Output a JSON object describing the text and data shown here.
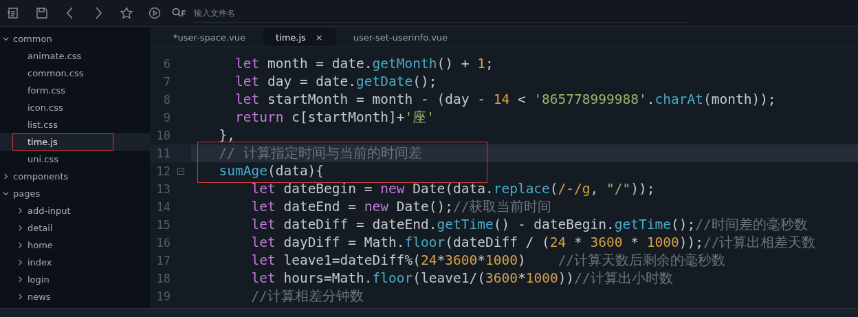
{
  "toolbar": {
    "icons": [
      {
        "kind": "new-file"
      },
      {
        "kind": "save"
      },
      {
        "kind": "back"
      },
      {
        "kind": "forward"
      },
      {
        "kind": "star"
      },
      {
        "kind": "run"
      }
    ],
    "search": {
      "placeholder": "输入文件名"
    }
  },
  "sidebar": {
    "items": [
      {
        "label": "common",
        "expanded": true,
        "selected": false,
        "outlined": false,
        "children": [
          {
            "label": "animate.css",
            "selected": false,
            "outlined": false
          },
          {
            "label": "common.css",
            "selected": false,
            "outlined": false
          },
          {
            "label": "form.css",
            "selected": false,
            "outlined": false
          },
          {
            "label": "icon.css",
            "selected": false,
            "outlined": false
          },
          {
            "label": "list.css",
            "selected": false,
            "outlined": false
          },
          {
            "label": "time.js",
            "selected": true,
            "outlined": true
          },
          {
            "label": "uni.css",
            "selected": false,
            "outlined": false
          }
        ]
      },
      {
        "label": "components",
        "expanded": false,
        "selected": false,
        "outlined": false
      },
      {
        "label": "pages",
        "expanded": true,
        "selected": false,
        "outlined": false,
        "children": [
          {
            "label": "add-input",
            "expanded": false,
            "selected": false,
            "outlined": false
          },
          {
            "label": "detail",
            "expanded": false,
            "selected": false,
            "outlined": false
          },
          {
            "label": "home",
            "expanded": false,
            "selected": false,
            "outlined": false
          },
          {
            "label": "index",
            "expanded": false,
            "selected": false,
            "outlined": false
          },
          {
            "label": "login",
            "expanded": false,
            "selected": false,
            "outlined": false
          },
          {
            "label": "news",
            "expanded": false,
            "selected": false,
            "outlined": false
          }
        ]
      }
    ]
  },
  "tabs": [
    {
      "label": "*user-space.vue",
      "selected": false
    },
    {
      "label": "time.js",
      "selected": true,
      "close": "×"
    },
    {
      "label": "user-set-userinfo.vue",
      "selected": false
    }
  ],
  "editor": {
    "lines": [
      {
        "number": "6",
        "current": false,
        "outlined": false,
        "foldable": false,
        "tokens": [
          {
            "kind": "kw",
            "text": "    let"
          },
          {
            "kind": "plain",
            "text": " month = date."
          },
          {
            "kind": "fn",
            "text": "getMonth"
          },
          {
            "kind": "plain",
            "text": "() + "
          },
          {
            "kind": "num",
            "text": "1"
          },
          {
            "kind": "plain",
            "text": ";"
          }
        ]
      },
      {
        "number": "7",
        "current": false,
        "outlined": false,
        "foldable": false,
        "tokens": [
          {
            "kind": "kw",
            "text": "    let"
          },
          {
            "kind": "plain",
            "text": " day = date."
          },
          {
            "kind": "fn",
            "text": "getDate"
          },
          {
            "kind": "plain",
            "text": "();"
          }
        ]
      },
      {
        "number": "8",
        "current": false,
        "outlined": false,
        "foldable": false,
        "tokens": [
          {
            "kind": "kw",
            "text": "    let"
          },
          {
            "kind": "plain",
            "text": " startMonth = month - (day - "
          },
          {
            "kind": "num",
            "text": "14"
          },
          {
            "kind": "plain",
            "text": " < "
          },
          {
            "kind": "str",
            "text": "'865778999988'"
          },
          {
            "kind": "plain",
            "text": "."
          },
          {
            "kind": "fn",
            "text": "charAt"
          },
          {
            "kind": "plain",
            "text": "(month));"
          }
        ]
      },
      {
        "number": "9",
        "current": false,
        "outlined": false,
        "foldable": false,
        "tokens": [
          {
            "kind": "kw",
            "text": "    return"
          },
          {
            "kind": "plain",
            "text": " c[startMonth]+"
          },
          {
            "kind": "str",
            "text": "'座'"
          }
        ]
      },
      {
        "number": "10",
        "current": false,
        "outlined": false,
        "foldable": false,
        "tokens": [
          {
            "kind": "plain",
            "text": "  },"
          }
        ]
      },
      {
        "number": "11",
        "current": true,
        "outlined": true,
        "foldable": false,
        "tokens": [
          {
            "kind": "cmt",
            "text": "  // 计算指定时间与当前的时间差"
          }
        ]
      },
      {
        "number": "12",
        "current": false,
        "outlined": true,
        "foldable": true,
        "tokens": [
          {
            "kind": "fn",
            "text": "  sumAge"
          },
          {
            "kind": "plain",
            "text": "(data){"
          }
        ]
      },
      {
        "number": "13",
        "current": false,
        "outlined": false,
        "foldable": false,
        "tokens": [
          {
            "kind": "kw",
            "text": "      let"
          },
          {
            "kind": "plain",
            "text": " dateBegin = "
          },
          {
            "kind": "kw",
            "text": "new"
          },
          {
            "kind": "plain",
            "text": " Date(data."
          },
          {
            "kind": "fn",
            "text": "replace"
          },
          {
            "kind": "plain",
            "text": "("
          },
          {
            "kind": "num",
            "text": "/-/g"
          },
          {
            "kind": "plain",
            "text": ", "
          },
          {
            "kind": "str",
            "text": "\"/\""
          },
          {
            "kind": "plain",
            "text": "));"
          }
        ]
      },
      {
        "number": "14",
        "current": false,
        "outlined": false,
        "foldable": false,
        "tokens": [
          {
            "kind": "kw",
            "text": "      let"
          },
          {
            "kind": "plain",
            "text": " dateEnd = "
          },
          {
            "kind": "kw",
            "text": "new"
          },
          {
            "kind": "plain",
            "text": " Date();"
          },
          {
            "kind": "cmt",
            "text": "//获取当前时间"
          }
        ]
      },
      {
        "number": "15",
        "current": false,
        "outlined": false,
        "foldable": false,
        "tokens": [
          {
            "kind": "kw",
            "text": "      let"
          },
          {
            "kind": "plain",
            "text": " dateDiff = dateEnd."
          },
          {
            "kind": "fn",
            "text": "getTime"
          },
          {
            "kind": "plain",
            "text": "() - dateBegin."
          },
          {
            "kind": "fn",
            "text": "getTime"
          },
          {
            "kind": "plain",
            "text": "();"
          },
          {
            "kind": "cmt",
            "text": "//时间差的毫秒数"
          }
        ]
      },
      {
        "number": "16",
        "current": false,
        "outlined": false,
        "foldable": false,
        "tokens": [
          {
            "kind": "kw",
            "text": "      let"
          },
          {
            "kind": "plain",
            "text": " dayDiff = Math."
          },
          {
            "kind": "fn",
            "text": "floor"
          },
          {
            "kind": "plain",
            "text": "(dateDiff / ("
          },
          {
            "kind": "num",
            "text": "24"
          },
          {
            "kind": "plain",
            "text": " * "
          },
          {
            "kind": "num",
            "text": "3600"
          },
          {
            "kind": "plain",
            "text": " * "
          },
          {
            "kind": "num",
            "text": "1000"
          },
          {
            "kind": "plain",
            "text": "));"
          },
          {
            "kind": "cmt",
            "text": "//计算出相差天数"
          }
        ]
      },
      {
        "number": "17",
        "current": false,
        "outlined": false,
        "foldable": false,
        "tokens": [
          {
            "kind": "kw",
            "text": "      let"
          },
          {
            "kind": "plain",
            "text": " leave1=dateDiff%("
          },
          {
            "kind": "num",
            "text": "24"
          },
          {
            "kind": "plain",
            "text": "*"
          },
          {
            "kind": "num",
            "text": "3600"
          },
          {
            "kind": "plain",
            "text": "*"
          },
          {
            "kind": "num",
            "text": "1000"
          },
          {
            "kind": "plain",
            "text": ")    "
          },
          {
            "kind": "cmt",
            "text": "//计算天数后剩余的毫秒数"
          }
        ]
      },
      {
        "number": "18",
        "current": false,
        "outlined": false,
        "foldable": false,
        "tokens": [
          {
            "kind": "kw",
            "text": "      let"
          },
          {
            "kind": "plain",
            "text": " hours=Math."
          },
          {
            "kind": "fn",
            "text": "floor"
          },
          {
            "kind": "plain",
            "text": "(leave1/("
          },
          {
            "kind": "num",
            "text": "3600"
          },
          {
            "kind": "plain",
            "text": "*"
          },
          {
            "kind": "num",
            "text": "1000"
          },
          {
            "kind": "plain",
            "text": "))"
          },
          {
            "kind": "cmt",
            "text": "//计算出小时数"
          }
        ]
      },
      {
        "number": "19",
        "current": false,
        "outlined": false,
        "foldable": false,
        "tokens": [
          {
            "kind": "cmt",
            "text": "      //计算相差分钟数"
          }
        ]
      }
    ]
  }
}
